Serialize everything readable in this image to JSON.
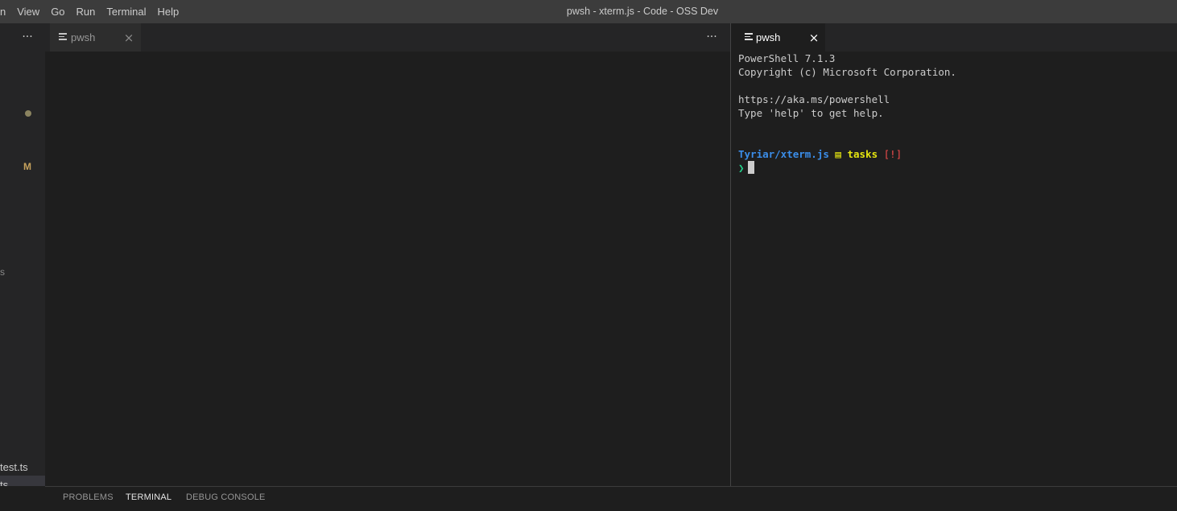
{
  "titlebar": {
    "menu": [
      {
        "label": "n"
      },
      {
        "label": "View"
      },
      {
        "label": "Go"
      },
      {
        "label": "Run"
      },
      {
        "label": "Terminal"
      },
      {
        "label": "Help"
      }
    ],
    "window_title": "pwsh - xterm.js - Code - OSS Dev"
  },
  "sidebar": {
    "more_glyph": "···",
    "modified_badge": "M",
    "fragments": [
      "s",
      "test.ts",
      "ts",
      "s"
    ]
  },
  "editor1": {
    "tab": {
      "label": "pwsh",
      "close_glyph": "×"
    },
    "more_glyph": "···"
  },
  "editor2": {
    "tab": {
      "label": "pwsh",
      "close_glyph": "×"
    }
  },
  "terminal": {
    "lines": [
      "PowerShell 7.1.3",
      "Copyright (c) Microsoft Corporation.",
      "",
      "https://aka.ms/powershell",
      "Type 'help' to get help."
    ],
    "prompt": {
      "path": "Tyriar/xterm.js",
      "branch_icon": "▤",
      "branch": "tasks",
      "status": "[!]",
      "arrow": "❯"
    }
  },
  "panel": {
    "tabs": [
      {
        "label": "PROBLEMS",
        "active": false
      },
      {
        "label": "TERMINAL",
        "active": true
      },
      {
        "label": "DEBUG CONSOLE",
        "active": false
      }
    ]
  },
  "colors": {
    "titlebar_bg": "#3c3c3c",
    "editor_bg": "#1e1e1e",
    "sidebar_bg": "#252526",
    "prompt_path": "#3b8eea",
    "prompt_branch": "#e5e510",
    "prompt_status": "#f14c4c",
    "prompt_arrow": "#23d18b"
  }
}
